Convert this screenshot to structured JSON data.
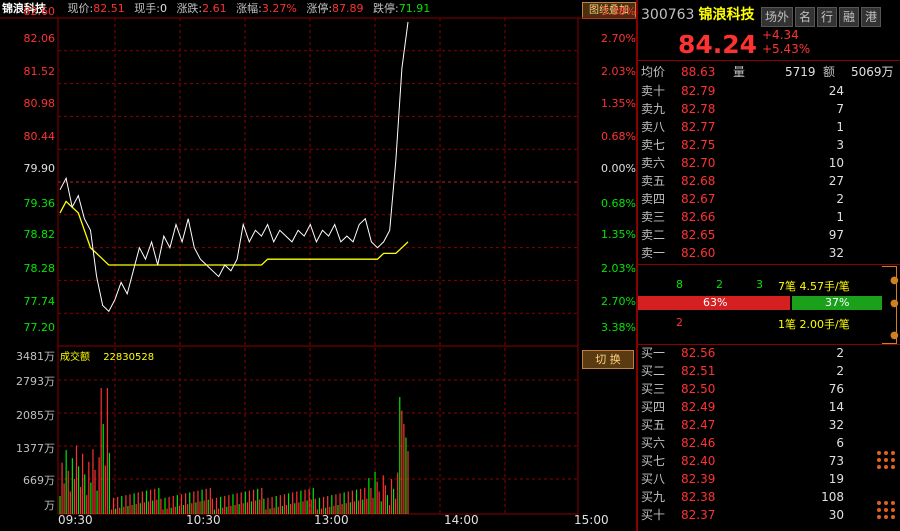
{
  "topbar": {
    "stock_name": "锦浪科技",
    "items": [
      {
        "label": "现价:",
        "value": "82.51",
        "color": "red"
      },
      {
        "label": "现手:",
        "value": "0",
        "color": "white"
      },
      {
        "label": "涨跌:",
        "value": "2.61",
        "color": "red"
      },
      {
        "label": "涨幅:",
        "value": "3.27%",
        "color": "red"
      },
      {
        "label": "涨停:",
        "value": "87.89",
        "color": "red"
      },
      {
        "label": "跌停:",
        "value": "71.91",
        "color": "green"
      }
    ],
    "overlay_button": "图线叠加"
  },
  "price_axis": [
    "82.60",
    "82.06",
    "81.52",
    "80.98",
    "80.44",
    "79.90",
    "79.36",
    "78.82",
    "78.28",
    "77.74",
    "77.20"
  ],
  "pct_axis": [
    "3.38%",
    "2.70%",
    "2.03%",
    "1.35%",
    "0.68%",
    "0.00%",
    "0.68%",
    "1.35%",
    "2.03%",
    "2.70%",
    "3.38%"
  ],
  "volume_axis": [
    "3481万",
    "2793万",
    "2085万",
    "1377万",
    "669万",
    "万"
  ],
  "volume_title": {
    "label": "成交额",
    "value": "22830528"
  },
  "switch_button": "切 换",
  "time_axis": [
    "09:30",
    "10:30",
    "13:00",
    "14:00",
    "15:00"
  ],
  "header": {
    "code": "300763",
    "name": "锦浪科技",
    "tabs": [
      "场外",
      "名",
      "行",
      "融",
      "港"
    ],
    "price": "84.24",
    "change": "+4.34",
    "change_pct": "+5.43%"
  },
  "stats": {
    "avg_label": "均价",
    "avg_value": "88.63",
    "vol_label": "量",
    "vol_value": "5719",
    "amt_label": "额",
    "amt_value": "5069万"
  },
  "asks": [
    {
      "label": "卖十",
      "price": "82.79",
      "vol": "24"
    },
    {
      "label": "卖九",
      "price": "82.78",
      "vol": "7"
    },
    {
      "label": "卖八",
      "price": "82.77",
      "vol": "1"
    },
    {
      "label": "卖七",
      "price": "82.75",
      "vol": "3"
    },
    {
      "label": "卖六",
      "price": "82.70",
      "vol": "10"
    },
    {
      "label": "卖五",
      "price": "82.68",
      "vol": "27"
    },
    {
      "label": "卖四",
      "price": "82.67",
      "vol": "2"
    },
    {
      "label": "卖三",
      "price": "82.66",
      "vol": "1"
    },
    {
      "label": "卖二",
      "price": "82.65",
      "vol": "97"
    },
    {
      "label": "卖一",
      "price": "82.60",
      "vol": "32"
    }
  ],
  "trade": {
    "line1": [
      "8",
      "2",
      "3",
      "7笔 4.57手/笔"
    ],
    "line2": [
      "2",
      "1笔 2.00手/笔"
    ],
    "red_pct": "63%",
    "green_pct": "37%",
    "red_share": 0.63
  },
  "bids": [
    {
      "label": "买一",
      "price": "82.56",
      "vol": "2"
    },
    {
      "label": "买二",
      "price": "82.51",
      "vol": "2"
    },
    {
      "label": "买三",
      "price": "82.50",
      "vol": "76"
    },
    {
      "label": "买四",
      "price": "82.49",
      "vol": "14"
    },
    {
      "label": "买五",
      "price": "82.47",
      "vol": "32"
    },
    {
      "label": "买六",
      "price": "82.46",
      "vol": "6"
    },
    {
      "label": "买七",
      "price": "82.40",
      "vol": "73"
    },
    {
      "label": "买八",
      "price": "82.39",
      "vol": "19"
    },
    {
      "label": "买九",
      "price": "82.38",
      "vol": "108"
    },
    {
      "label": "买十",
      "price": "82.37",
      "vol": "30"
    }
  ],
  "colors": {
    "up": "#ff3232",
    "down": "#00e600",
    "grid": "#8b0000",
    "avg_line": "#ffff00",
    "price_line": "#ffffff"
  }
}
